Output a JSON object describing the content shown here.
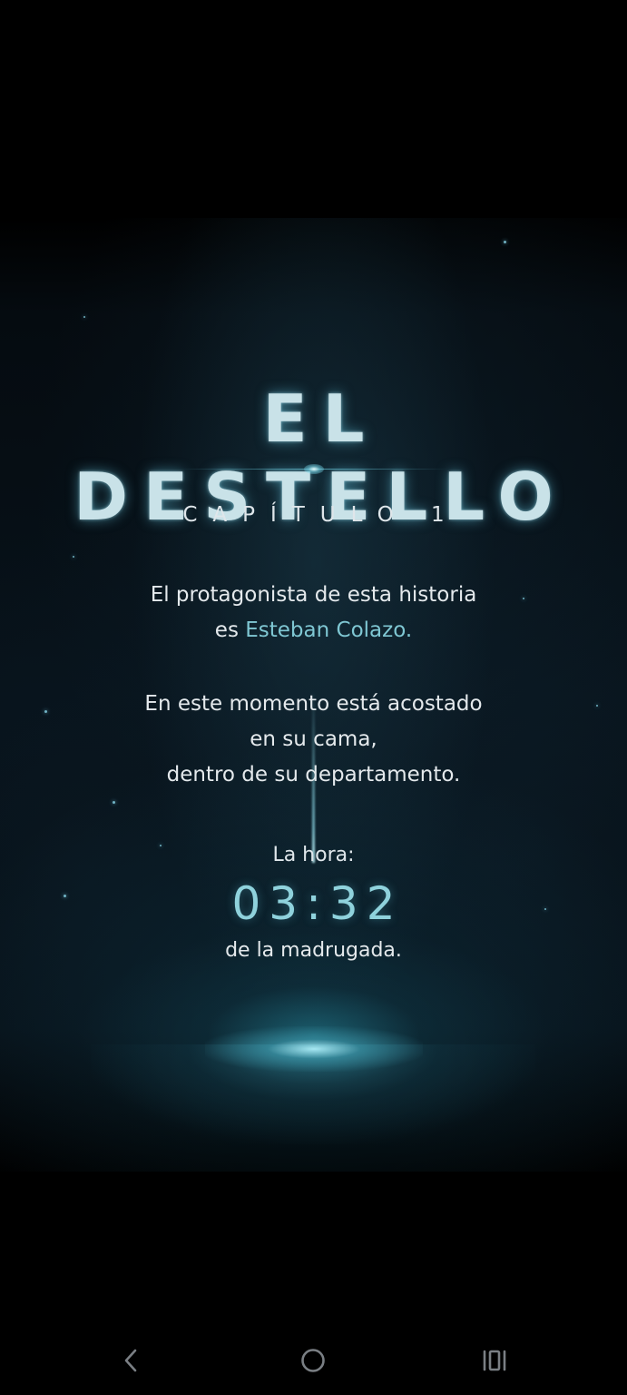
{
  "story": {
    "title": "EL DESTELLO",
    "chapter": "CAPÍTULO 1",
    "intro_line1": "El protagonista de esta historia",
    "intro_line2_prefix": "es ",
    "protagonist": "Esteban Colazo",
    "intro_line2_suffix": ".",
    "situation_line1": "En este momento está acostado",
    "situation_line2": "en su cama,",
    "situation_line3": "dentro de su departamento.",
    "time_label": "La hora:",
    "time_value": "03:32",
    "time_suffix": "de la madrugada."
  },
  "colors": {
    "background": "#000000",
    "accent": "#7fc7d3",
    "time": "#8fd2dc",
    "text": "#e4e9ec"
  },
  "navbar": {
    "back_icon": "chevron-left-icon",
    "home_icon": "circle-home-icon",
    "recent_icon": "recent-apps-icon"
  }
}
